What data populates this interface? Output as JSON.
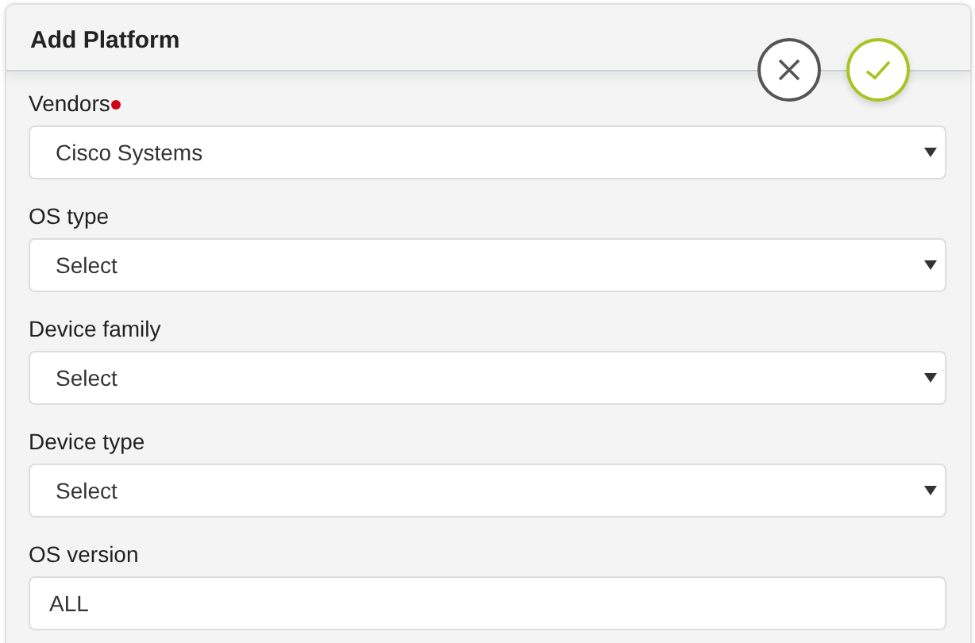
{
  "dialog": {
    "title": "Add Platform"
  },
  "actions": [
    {
      "kind": "cancel"
    },
    {
      "kind": "confirm"
    }
  ],
  "fields": [
    {
      "label": "Vendors",
      "required": true,
      "kind": "select",
      "value": "Cisco Systems"
    },
    {
      "label": "OS type",
      "required": false,
      "kind": "select",
      "value": "Select"
    },
    {
      "label": "Device family",
      "required": false,
      "kind": "select",
      "value": "Select"
    },
    {
      "label": "Device type",
      "required": false,
      "kind": "select",
      "value": "Select"
    },
    {
      "label": "OS version",
      "required": false,
      "kind": "text",
      "value": "ALL"
    }
  ]
}
